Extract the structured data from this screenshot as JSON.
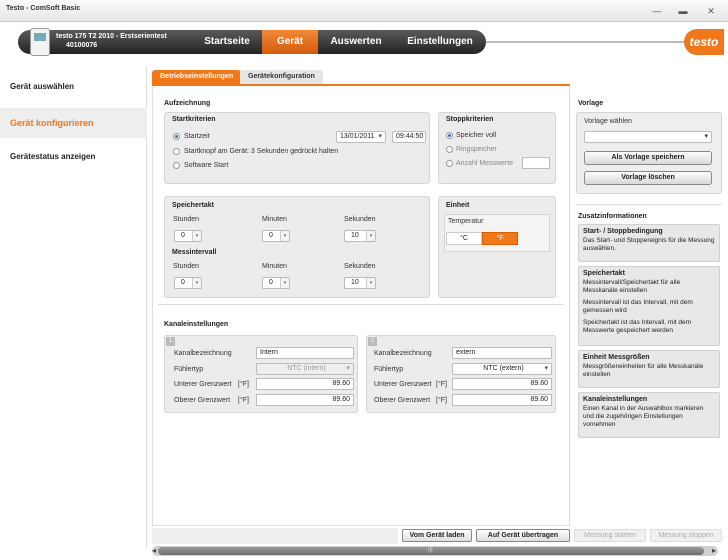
{
  "window": {
    "title": "Testo - ComSoft Basic",
    "minimize": "—",
    "restore": "▬",
    "close": "✕"
  },
  "header": {
    "device_line1": "testo 175 T2 2010 - Erstserientest",
    "device_line2": "40100076",
    "nav": [
      "Startseite",
      "Gerät",
      "Auswerten",
      "Einstellungen"
    ],
    "logo": "testo",
    "accent": "#f07818"
  },
  "sidebar": {
    "items": [
      "Gerät auswählen",
      "Gerät konfigurieren",
      "Gerätestatus anzeigen"
    ]
  },
  "tabs": [
    "Betriebseinstellungen",
    "Gerätekonfiguration"
  ],
  "aufzeichnung": {
    "title": "Aufzeichnung",
    "startkriterien": {
      "title": "Startkriterien",
      "startzeit": "Startzeit",
      "date": "13/01/2011",
      "time": "09:44:50",
      "startknopf": "Startknopf am Gerät: 3 Sekunden gedrückt halten",
      "software": "Software Start"
    },
    "stoppkriterien": {
      "title": "Stoppkriterien",
      "speicher_voll": "Speicher voll",
      "ringspeicher": "Ringspeicher",
      "anzahl": "Anzahl Messwerte"
    },
    "speichertakt": {
      "title": "Speichertakt",
      "labels": [
        "Stunden",
        "Minuten",
        "Sekunden"
      ],
      "values": [
        "0",
        "0",
        "10"
      ]
    },
    "messintervall": {
      "title": "Messintervall",
      "labels": [
        "Stunden",
        "Minuten",
        "Sekunden"
      ],
      "values": [
        "0",
        "0",
        "10"
      ]
    },
    "einheit": {
      "title": "Einheit",
      "temperatur": "Temperatur",
      "c": "°C",
      "f": "°F"
    }
  },
  "kanal": {
    "title": "Kanaleinstellungen",
    "labels": {
      "bez": "Kanalbezeichnung",
      "typ": "Fühlertyp",
      "unter": "Unterer Grenzwert",
      "ober": "Oberer Grenzwert",
      "unit": "[°F]"
    },
    "ch1": {
      "num": "1",
      "name": "Intern",
      "typ": "NTC (intern)",
      "unter": "89.60",
      "ober": "89.60"
    },
    "ch2": {
      "num": "2",
      "name": "extern",
      "typ": "NTC (extern)",
      "unter": "89.60",
      "ober": "89.60"
    }
  },
  "vorlage": {
    "title": "Vorlage",
    "waehlen": "Vorlage wählen",
    "save": "Als Vorlage speichern",
    "delete": "Vorlage löschen"
  },
  "zusatz": {
    "title": "Zusatzinformationen",
    "boxes": [
      {
        "t": "Start- / Stoppbedingung",
        "d1": "Das Start- und Stoppereignis für die Messung auswählen.",
        "d2": "",
        "d3": ""
      },
      {
        "t": "Speichertakt",
        "d1": "Messintervall/Speichertakt für alle Messkanäle einstellen",
        "d2": "Messintervall ist das Intervall, mit dem gemessen wird",
        "d3": "Speichertakt ist das Intervall, mit dem Messwerte gespeichert werden"
      },
      {
        "t": "Einheit Messgrößen",
        "d1": "Messgrößeneinheiten für alle Messkanäle einstellen",
        "d2": "",
        "d3": ""
      },
      {
        "t": "Kanaleinstellungen",
        "d1": "Einen Kanal in der Auswahlbox markieren und die zugehörigen Einstellungen vornehmen",
        "d2": "",
        "d3": ""
      }
    ]
  },
  "bottom": {
    "laden": "Vom Gerät laden",
    "uebertragen": "Auf Gerät übertragen",
    "start": "Messung starten",
    "stop": "Messung stoppen"
  },
  "scroll": {
    "left": "◂",
    "right": "▸",
    "grip": "|||"
  },
  "glyphs": {
    "dropdown": "▾",
    "spin": "▾"
  }
}
